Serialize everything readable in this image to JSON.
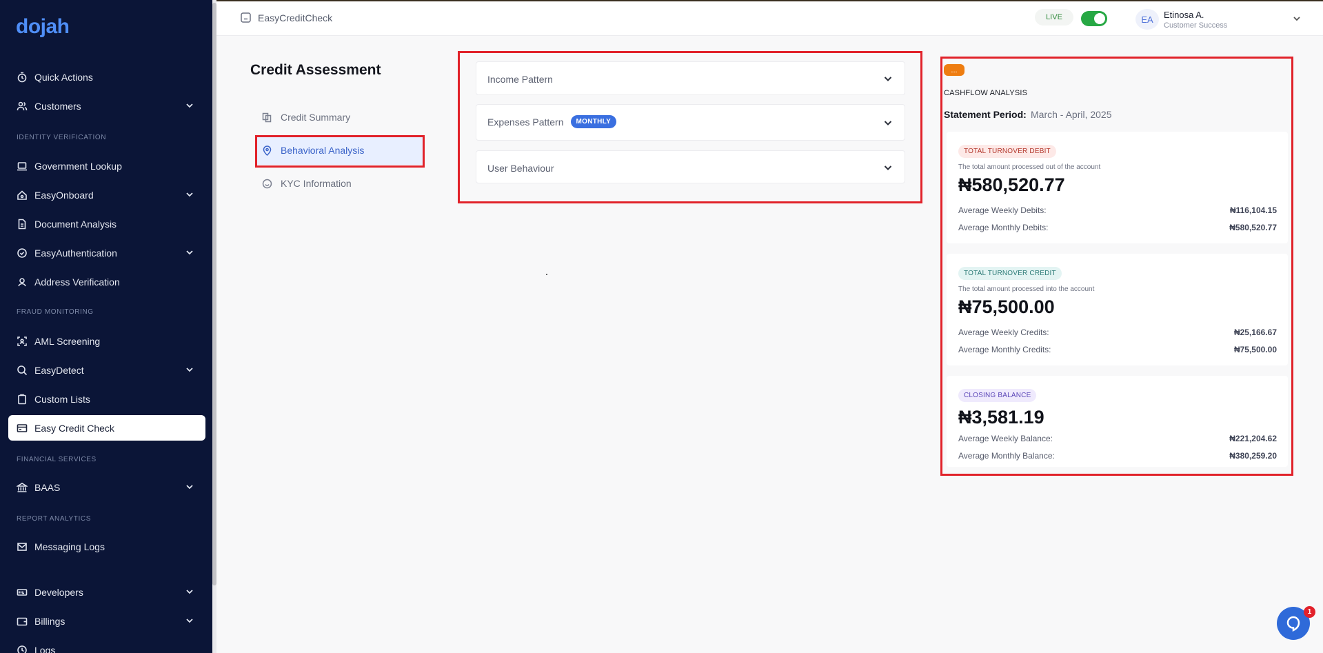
{
  "sidebar": {
    "logo": "dojah",
    "items": [
      {
        "label": "Quick Actions",
        "icon": "stopwatch-icon"
      },
      {
        "label": "Customers",
        "icon": "users-icon"
      },
      {
        "label": "Government Lookup",
        "icon": "laptop-icon"
      },
      {
        "label": "EasyOnboard",
        "icon": "home-icon"
      },
      {
        "label": "Document Analysis",
        "icon": "document-icon"
      },
      {
        "label": "EasyAuthentication",
        "icon": "badge-check-icon"
      },
      {
        "label": "Address Verification",
        "icon": "location-icon"
      },
      {
        "label": "AML Screening",
        "icon": "scan-icon"
      },
      {
        "label": "EasyDetect",
        "icon": "search-icon"
      },
      {
        "label": "Custom Lists",
        "icon": "clipboard-icon"
      },
      {
        "label": "Easy Credit Check",
        "icon": "card-icon"
      },
      {
        "label": "BAAS",
        "icon": "bank-icon"
      },
      {
        "label": "Messaging Logs",
        "icon": "mail-icon"
      },
      {
        "label": "Developers",
        "icon": "dev-icon"
      },
      {
        "label": "Billings",
        "icon": "wallet-icon"
      },
      {
        "label": "Logs",
        "icon": "clock-icon"
      }
    ],
    "sections": {
      "identity": "IDENTITY VERIFICATION",
      "fraud": "FRAUD MONITORING",
      "financial": "FINANCIAL SERVICES",
      "report": "REPORT ANALYTICS"
    }
  },
  "header": {
    "breadcrumb": "EasyCreditCheck",
    "live_label": "LIVE",
    "avatar_initials": "EA",
    "user_name": "Etinosa A.",
    "user_role": "Customer Success"
  },
  "page": {
    "title": "Credit Assessment",
    "subnav": [
      {
        "label": "Credit Summary"
      },
      {
        "label": "Behavioral Analysis"
      },
      {
        "label": "KYC Information"
      }
    ]
  },
  "accordions": [
    {
      "label": "Income Pattern"
    },
    {
      "label": "Expenses Pattern",
      "pill": "MONTHLY"
    },
    {
      "label": "User Behaviour"
    }
  ],
  "cashflow": {
    "badge": "...",
    "title": "CASHFLOW ANALYSIS",
    "period_label": "Statement Period:",
    "period_value": "March - April, 2025",
    "cards": [
      {
        "tag": "TOTAL TURNOVER DEBIT",
        "tag_bg": "#fde9e7",
        "tag_color": "#b3372c",
        "desc": "The total amount processed out of the account",
        "amount": "₦580,520.77",
        "rows": [
          {
            "label": "Average Weekly Debits:",
            "value": "₦116,104.15"
          },
          {
            "label": "Average Monthly Debits:",
            "value": "₦580,520.77"
          }
        ]
      },
      {
        "tag": "TOTAL TURNOVER CREDIT",
        "tag_bg": "#e3f4f3",
        "tag_color": "#2b7a76",
        "desc": "The total amount processed into the account",
        "amount": "₦75,500.00",
        "rows": [
          {
            "label": "Average Weekly Credits:",
            "value": "₦25,166.67"
          },
          {
            "label": "Average Monthly Credits:",
            "value": "₦75,500.00"
          }
        ]
      },
      {
        "tag": "CLOSING BALANCE",
        "tag_bg": "#efeafd",
        "tag_color": "#5b46b8",
        "amount": "₦3,581.19",
        "rows": [
          {
            "label": "Average Weekly Balance:",
            "value": "₦221,204.62"
          },
          {
            "label": "Average Monthly Balance:",
            "value": "₦380,259.20"
          }
        ]
      }
    ]
  },
  "chat": {
    "count": "1"
  },
  "colors": {
    "sidebar_bg": "#0b1537",
    "accent": "#3a6fe0",
    "live_green": "#27a844",
    "highlight_red": "#e1222a"
  }
}
